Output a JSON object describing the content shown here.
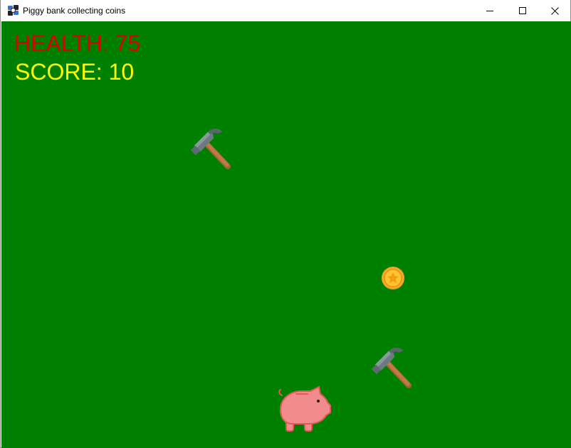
{
  "window": {
    "title": "Piggy bank collecting coins"
  },
  "hud": {
    "health_text": "HEALTH: 75",
    "score_text": "SCORE: 10",
    "health_color": "#dd0000",
    "score_color": "#ffff00"
  },
  "game": {
    "background_color": "#008000",
    "health": 75,
    "score": 10,
    "sprites": [
      "hammer-icon",
      "hammer-icon",
      "coin-icon",
      "piggy-bank-icon"
    ]
  }
}
